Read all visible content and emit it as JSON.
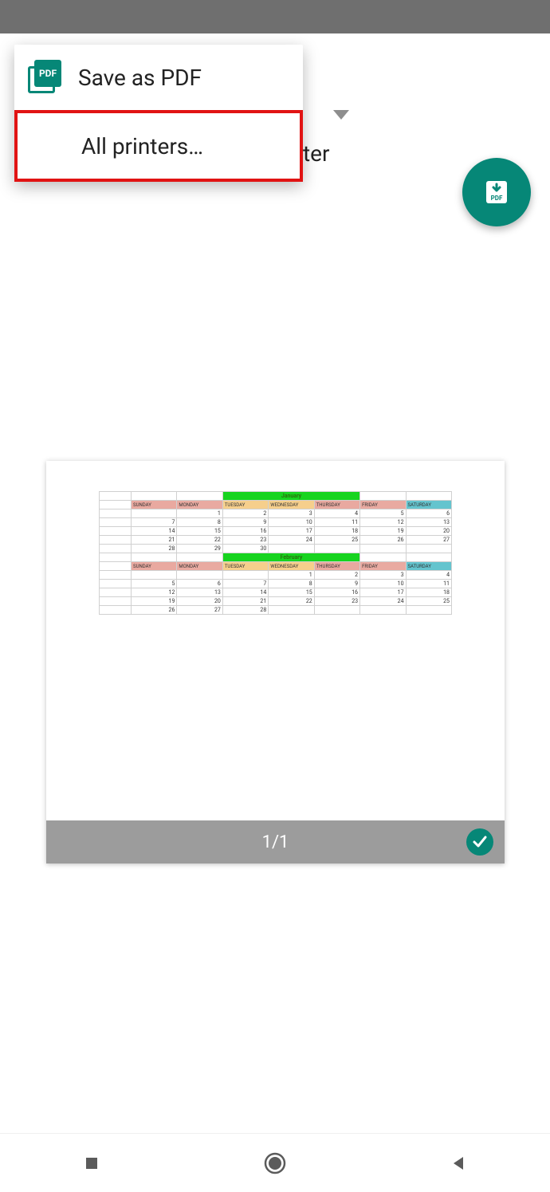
{
  "colors": {
    "accent": "#068777",
    "highlight": "#e11313",
    "month_bg": "#17d41f"
  },
  "toolbar": {
    "hidden_text_fragment": "ter",
    "dropdown_icon": "chevron-down-icon",
    "items": [
      {
        "label": "Save as PDF",
        "icon": "pdf-icon"
      },
      {
        "label": "All printers…"
      }
    ]
  },
  "fab": {
    "icon": "download-pdf-icon",
    "label": "PDF"
  },
  "preview": {
    "page_indicator": "1/1",
    "selected": true,
    "months": [
      {
        "name": "January",
        "headers": [
          "SUNDAY",
          "MONDAY",
          "TUESDAY",
          "WEDNESDAY",
          "THURSDAY",
          "FRIDAY",
          "SATURDAY"
        ],
        "rows": [
          [
            "",
            "",
            "1",
            "2",
            "3",
            "4",
            "5",
            "6"
          ],
          [
            "",
            "7",
            "8",
            "9",
            "10",
            "11",
            "12",
            "13"
          ],
          [
            "",
            "14",
            "15",
            "16",
            "17",
            "18",
            "19",
            "20"
          ],
          [
            "",
            "21",
            "22",
            "23",
            "24",
            "25",
            "26",
            "27"
          ],
          [
            "",
            "28",
            "29",
            "30",
            "",
            "",
            "",
            ""
          ]
        ]
      },
      {
        "name": "February",
        "headers": [
          "SUNDAY",
          "MONDAY",
          "TUESDAY",
          "WEDNESDAY",
          "THURSDAY",
          "FRIDAY",
          "SATURDAY"
        ],
        "rows": [
          [
            "",
            "",
            "",
            "",
            "1",
            "2",
            "3",
            "4"
          ],
          [
            "",
            "5",
            "6",
            "7",
            "8",
            "9",
            "10",
            "11"
          ],
          [
            "",
            "12",
            "13",
            "14",
            "15",
            "16",
            "17",
            "18"
          ],
          [
            "",
            "19",
            "20",
            "21",
            "22",
            "23",
            "24",
            "25"
          ],
          [
            "",
            "26",
            "27",
            "28",
            "",
            "",
            "",
            ""
          ]
        ]
      }
    ]
  },
  "navbar": {
    "items": [
      "recent",
      "home",
      "back"
    ]
  }
}
